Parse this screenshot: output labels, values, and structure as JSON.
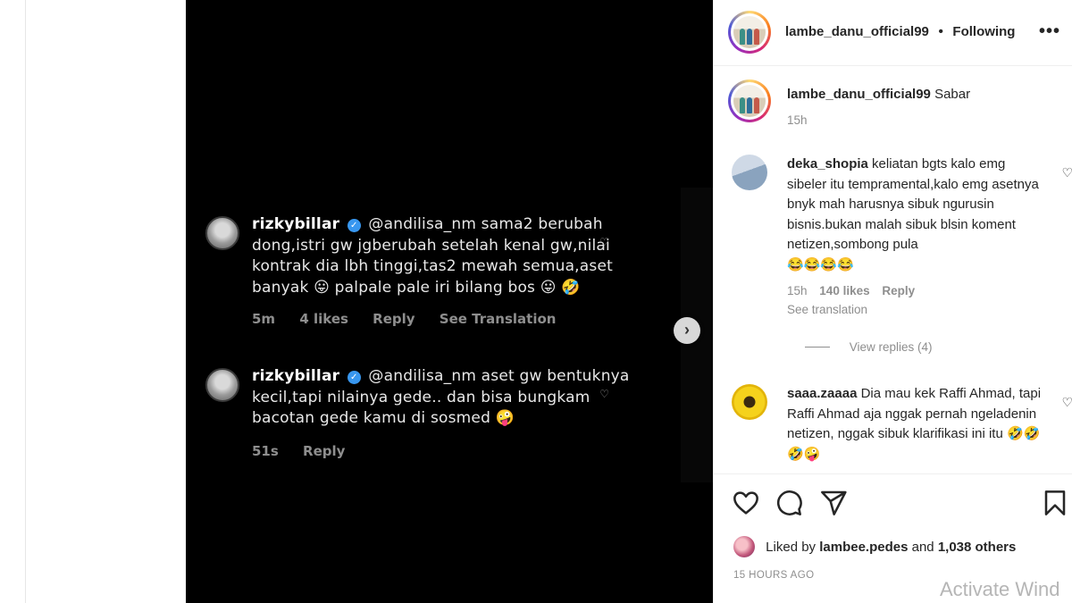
{
  "media": {
    "comments": [
      {
        "username": "rizkybillar",
        "verified_icon": "verified-badge-icon",
        "text": "@andilisa_nm sama2 berubah dong,istri gw jgberubah setelah kenal gw,nilai kontrak dia lbh tinggi,tas2 mewah semua,aset banyak",
        "tail": "palpale pale iri bilang bos",
        "emojis_mid": "😛",
        "emojis_end": "😛 🤣",
        "time": "5m",
        "likes": "4 likes",
        "reply": "Reply",
        "see_translation": "See Translation"
      },
      {
        "username": "rizkybillar",
        "verified_icon": "verified-badge-icon",
        "text": "@andilisa_nm aset gw bentuknya kecil,tapi nilainya gede.. dan bisa bungkam bacotan gede kamu di sosmed",
        "emojis_end": "🤪",
        "time": "51s",
        "reply": "Reply"
      }
    ],
    "next_icon": "chevron-right-icon",
    "next_glyph": "›"
  },
  "panel": {
    "header": {
      "username": "lambe_danu_official99",
      "separator": "•",
      "following": "Following",
      "more": "•••"
    },
    "caption": {
      "username": "lambe_danu_official99",
      "text": "Sabar",
      "time": "15h"
    },
    "comments": [
      {
        "username": "deka_shopia",
        "text": "keliatan bgts kalo emg sibeler itu tempramental,kalo emg asetnya bnyk mah harusnya sibuk ngurusin bisnis.bukan malah sibuk blsin koment netizen,sombong pula",
        "emojis": "😂😂😂😂",
        "time": "15h",
        "likes": "140 likes",
        "reply": "Reply",
        "see_translation": "See translation",
        "view_replies": "View replies (4)"
      },
      {
        "username": "saaa.zaaaa",
        "text": "Dia mau kek Raffi Ahmad, tapi Raffi Ahmad aja nggak pernah ngeladenin netizen, nggak sibuk klarifikasi ini itu",
        "emojis": "🤣🤣🤣🤪"
      }
    ],
    "liked_by": {
      "prefix": "Liked by",
      "user": "lambee.pedes",
      "and": "and",
      "others": "1,038 others"
    },
    "timestamp": "15 HOURS AGO"
  },
  "watermark": "Activate Wind",
  "icons": [
    "heart-icon",
    "comment-icon",
    "share-icon",
    "bookmark-icon",
    "more-icon"
  ]
}
